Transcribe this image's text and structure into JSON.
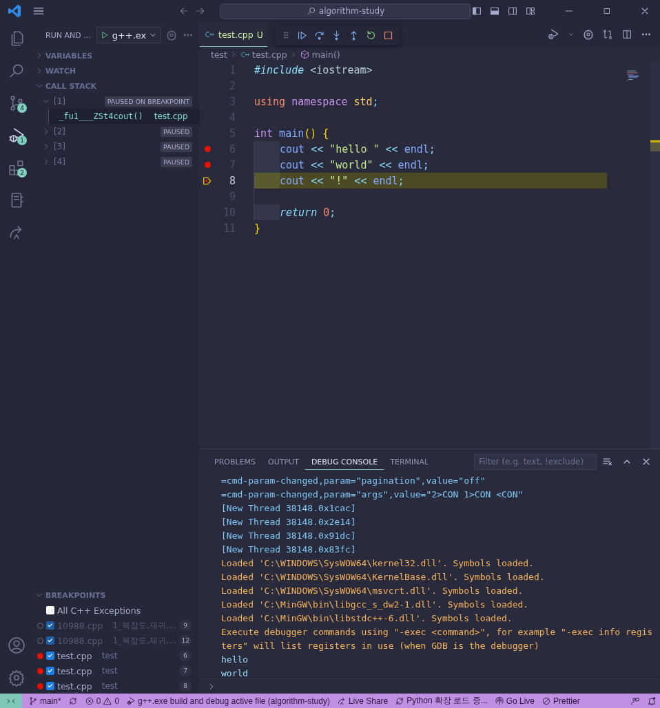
{
  "title_bar": {
    "search": "algorithm-study"
  },
  "activity_bar": {
    "items": [
      {
        "kind": "files",
        "selected": false
      },
      {
        "kind": "search",
        "selected": false
      },
      {
        "kind": "source-control",
        "badge": "4",
        "selected": false
      },
      {
        "kind": "run-debug",
        "badge": "1",
        "selected": true
      },
      {
        "kind": "extensions",
        "badge": "2",
        "selected": false
      },
      {
        "kind": "notebook",
        "selected": false
      },
      {
        "kind": "live-share",
        "selected": false
      }
    ],
    "bottom": [
      {
        "kind": "account"
      },
      {
        "kind": "settings"
      }
    ]
  },
  "sidebar": {
    "title": "RUN AND ...",
    "configuration": "g++.ex",
    "sections": [
      {
        "title": "VARIABLES",
        "expanded": false
      },
      {
        "title": "WATCH",
        "expanded": false
      }
    ],
    "call_stack": {
      "title": "CALL STACK",
      "expanded": true,
      "threads": [
        {
          "label": "[1]",
          "expanded": true,
          "status": "PAUSED ON BREAKPOINT",
          "frames": [
            {
              "name": "_fu1___ZSt4cout()",
              "file": "test.cpp",
              "selected": true
            }
          ]
        },
        {
          "label": "[2]",
          "expanded": false,
          "status": "PAUSED"
        },
        {
          "label": "[3]",
          "expanded": false,
          "status": "PAUSED"
        },
        {
          "label": "[4]",
          "expanded": false,
          "status": "PAUSED"
        }
      ]
    },
    "breakpoints": {
      "title": "BREAKPOINTS",
      "expanded": true,
      "items": [
        {
          "kind": "exception",
          "label": "All C++ Exceptions",
          "checked": false
        },
        {
          "kind": "source",
          "file": "10988.cpp",
          "path": "1_복잡도,재귀,...",
          "line": "9",
          "checked": true,
          "verified": false
        },
        {
          "kind": "source",
          "file": "10988.cpp",
          "path": "1_복잡도,재귀,...",
          "line": "12",
          "checked": true,
          "verified": false
        },
        {
          "kind": "source",
          "file": "test.cpp",
          "path": "test",
          "line": "6",
          "checked": true,
          "verified": true
        },
        {
          "kind": "source",
          "file": "test.cpp",
          "path": "test",
          "line": "7",
          "checked": true,
          "verified": true
        },
        {
          "kind": "source",
          "file": "test.cpp",
          "path": "test",
          "line": "8",
          "checked": true,
          "verified": true
        }
      ]
    }
  },
  "editor": {
    "tabs": [
      {
        "label": "test.cpp",
        "status": "U",
        "selected": true
      }
    ],
    "debug_toolbar": [
      {
        "kind": "continue"
      },
      {
        "kind": "step-over"
      },
      {
        "kind": "step-into"
      },
      {
        "kind": "step-out"
      },
      {
        "kind": "restart"
      },
      {
        "kind": "stop"
      }
    ],
    "breadcrumbs": [
      {
        "kind": "folder",
        "label": "test"
      },
      {
        "kind": "file",
        "label": "test.cpp"
      },
      {
        "kind": "function",
        "label": "main()"
      }
    ],
    "lines": [
      {
        "number": "1",
        "breakpoint": false,
        "current": false,
        "indent": false,
        "tokens": [
          {
            "kind": "preprocessor",
            "text": "#include"
          },
          {
            "kind": "header",
            "text": " <iostream>"
          }
        ]
      },
      {
        "number": "2",
        "breakpoint": false,
        "current": false,
        "indent": false
      },
      {
        "number": "3",
        "breakpoint": false,
        "current": false,
        "indent": false,
        "tokens": [
          {
            "kind": "keyword",
            "text": "using"
          },
          {
            "kind": "storage",
            "text": " namespace"
          },
          {
            "kind": "namespace",
            "text": " std"
          },
          {
            "kind": "punct",
            "text": ";"
          }
        ]
      },
      {
        "number": "4",
        "breakpoint": false,
        "current": false,
        "indent": false
      },
      {
        "number": "5",
        "breakpoint": false,
        "current": false,
        "indent": false,
        "tokens": [
          {
            "kind": "storage",
            "text": "int"
          },
          {
            "kind": "function",
            "text": " main"
          },
          {
            "kind": "brace",
            "text": "() {"
          }
        ]
      },
      {
        "number": "6",
        "breakpoint": true,
        "current": false,
        "indent": true,
        "tokens": [
          {
            "kind": "variable",
            "text": "cout"
          },
          {
            "kind": "operator",
            "text": " << "
          },
          {
            "kind": "string",
            "text": "\"hello \""
          },
          {
            "kind": "operator",
            "text": " << "
          },
          {
            "kind": "variable",
            "text": "endl"
          },
          {
            "kind": "punct",
            "text": ";"
          }
        ]
      },
      {
        "number": "7",
        "breakpoint": true,
        "current": false,
        "indent": true,
        "tokens": [
          {
            "kind": "variable",
            "text": "cout"
          },
          {
            "kind": "operator",
            "text": " << "
          },
          {
            "kind": "string",
            "text": "\"world\""
          },
          {
            "kind": "operator",
            "text": " << "
          },
          {
            "kind": "variable",
            "text": "endl"
          },
          {
            "kind": "punct",
            "text": ";"
          }
        ]
      },
      {
        "number": "8",
        "breakpoint": true,
        "current": true,
        "indent": true,
        "tokens": [
          {
            "kind": "variable",
            "text": "cout"
          },
          {
            "kind": "operator",
            "text": " << "
          },
          {
            "kind": "string",
            "text": "\"!\""
          },
          {
            "kind": "operator",
            "text": " << "
          },
          {
            "kind": "variable",
            "text": "endl"
          },
          {
            "kind": "punct",
            "text": ";"
          }
        ]
      },
      {
        "number": "9",
        "breakpoint": false,
        "current": false,
        "indent": false
      },
      {
        "number": "10",
        "breakpoint": false,
        "current": false,
        "indent": true,
        "tokens": [
          {
            "kind": "control",
            "text": "return"
          },
          {
            "kind": "number",
            "text": " 0"
          },
          {
            "kind": "punct",
            "text": ";"
          }
        ]
      },
      {
        "number": "11",
        "breakpoint": false,
        "current": false,
        "indent": false,
        "tokens": [
          {
            "kind": "brace",
            "text": "}"
          }
        ]
      }
    ]
  },
  "panel": {
    "tabs": [
      {
        "label": "PROBLEMS",
        "selected": false
      },
      {
        "label": "OUTPUT",
        "selected": false
      },
      {
        "label": "DEBUG CONSOLE",
        "selected": true
      },
      {
        "label": "TERMINAL",
        "selected": false
      }
    ],
    "filter": {
      "placeholder": "Filter (e.g. text, !exclude)"
    },
    "lines": [
      {
        "kind": "info",
        "text": "=cmd-param-changed,param=\"pagination\",value=\"off\""
      },
      {
        "kind": "info",
        "text": "=cmd-param-changed,param=\"args\",value=\"2>CON 1>CON <CON\""
      },
      {
        "kind": "info",
        "text": "[New Thread 38148.0x1cac]"
      },
      {
        "kind": "info",
        "text": "[New Thread 38148.0x2e14]"
      },
      {
        "kind": "info",
        "text": "[New Thread 38148.0x91dc]"
      },
      {
        "kind": "info",
        "text": "[New Thread 38148.0x83fc]"
      },
      {
        "kind": "log",
        "text": "Loaded 'C:\\WINDOWS\\SysWOW64\\kernel32.dll'. Symbols loaded."
      },
      {
        "kind": "log",
        "text": "Loaded 'C:\\WINDOWS\\SysWOW64\\KernelBase.dll'. Symbols loaded."
      },
      {
        "kind": "log",
        "text": "Loaded 'C:\\WINDOWS\\SysWOW64\\msvcrt.dll'. Symbols loaded."
      },
      {
        "kind": "log",
        "text": "Loaded 'C:\\MinGW\\bin\\libgcc_s_dw2-1.dll'. Symbols loaded."
      },
      {
        "kind": "log",
        "text": "Loaded 'C:\\MinGW\\bin\\libstdc++-6.dll'. Symbols loaded."
      },
      {
        "kind": "log",
        "text": "Execute debugger commands using \"-exec <command>\", for example \"-exec info registers\" will list registers in use (when GDB is the debugger)"
      },
      {
        "kind": "output",
        "text": "hello"
      },
      {
        "kind": "output",
        "text": "world"
      }
    ]
  },
  "status_bar": {
    "items": [
      {
        "kind": "remote"
      },
      {
        "kind": "branch",
        "text": "main*"
      },
      {
        "kind": "sync"
      },
      {
        "kind": "problems",
        "errors": "0",
        "warnings": "0"
      },
      {
        "kind": "launch",
        "text": "g++.exe build and debug active file (algorithm-study)"
      },
      {
        "kind": "live-share",
        "text": "Live Share"
      },
      {
        "kind": "loading",
        "text": "Python 확장 로드 중..."
      },
      {
        "kind": "go-live",
        "text": "Go Live"
      },
      {
        "kind": "prettier",
        "text": "Prettier"
      },
      {
        "kind": "feedback"
      },
      {
        "kind": "notifications"
      }
    ]
  }
}
